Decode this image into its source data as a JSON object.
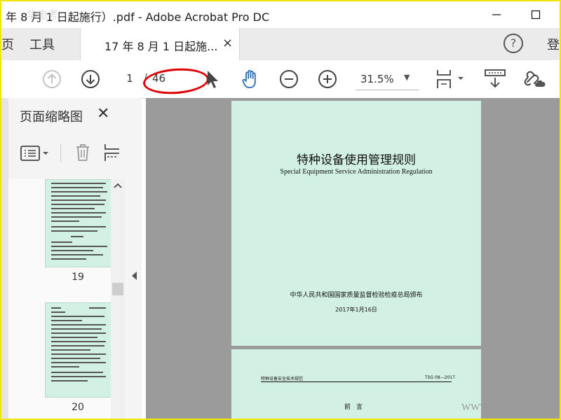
{
  "window": {
    "title": "年 8 月 1 日起施行）.pdf - Adobe Acrobat Pro DC",
    "watermark": "华电考"
  },
  "tabs": {
    "cut_label": "页",
    "tools_label": "工具",
    "document_label": "17 年 8 月 1 日起施...",
    "close_symbol": "×",
    "help_symbol": "?",
    "login_label": "登"
  },
  "toolbar": {
    "current_page": "1",
    "page_separator": "/",
    "page_count": "46",
    "zoom_value": "31.5%"
  },
  "panel": {
    "title": "页面缩略图",
    "close_symbol": "✕",
    "thumbnails": [
      {
        "label": "19"
      },
      {
        "label": "20"
      }
    ]
  },
  "document": {
    "page1": {
      "title": "特种设备使用管理规则",
      "subtitle": "Special Equipment Service Administration Regulation",
      "issuer": "中华人民共和国国家质量监督检验检疫总局颁布",
      "date": "2017年1月16日"
    },
    "page2": {
      "header_left": "特种设备安全技术规范",
      "header_right": "TSG 08—2017",
      "heading": "前言",
      "watermark": "WWW"
    }
  },
  "colors": {
    "highlight_border": "#f2e600",
    "annotation_ellipse": "#e00000",
    "page_background": "#d2f0e4",
    "doc_background": "#9b9b9b",
    "hand_tool_accent": "#2a6fb5"
  }
}
